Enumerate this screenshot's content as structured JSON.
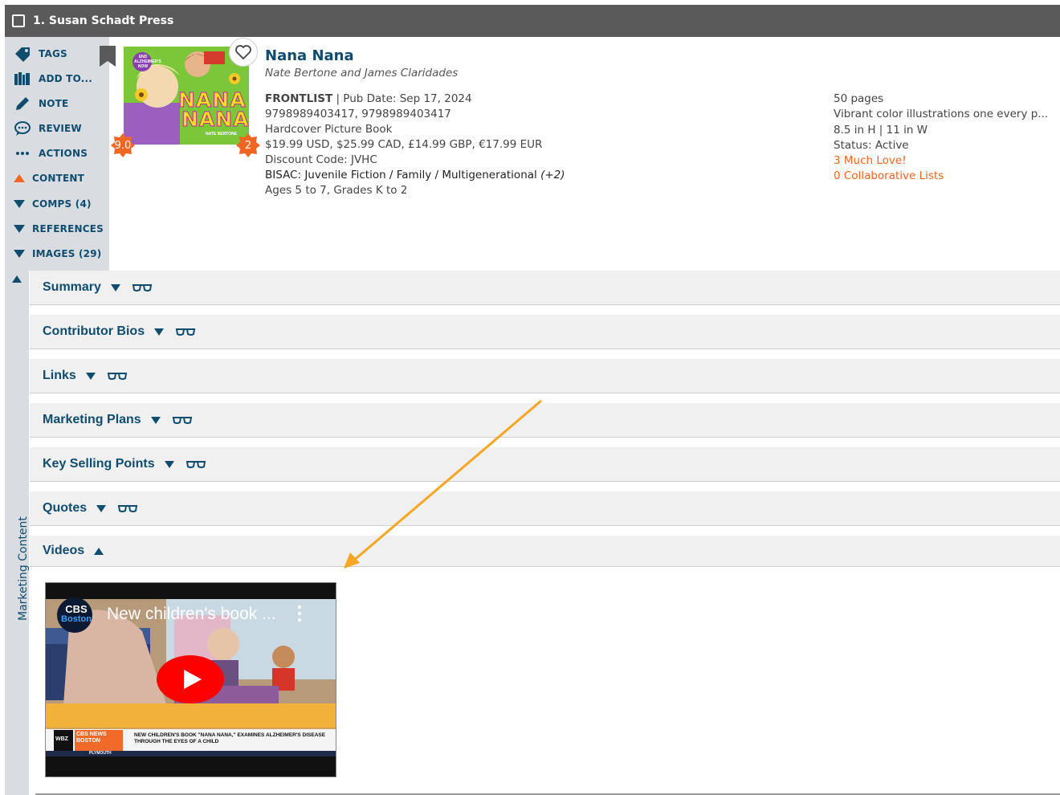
{
  "header": {
    "title": "1. Susan Schadt Press"
  },
  "sidebar": {
    "items": [
      {
        "label": "TAGS",
        "icon": "tag-icon"
      },
      {
        "label": "ADD TO...",
        "icon": "books-icon"
      },
      {
        "label": "NOTE",
        "icon": "pencil-icon"
      },
      {
        "label": "REVIEW",
        "icon": "speech-bubble-icon"
      },
      {
        "label": "ACTIONS",
        "icon": "ellipsis-icon"
      },
      {
        "label": "CONTENT",
        "icon": "triangle-up-icon"
      },
      {
        "label": "COMPS (4)",
        "icon": "triangle-down-icon"
      },
      {
        "label": "REFERENCES",
        "icon": "triangle-down-icon"
      },
      {
        "label": "IMAGES (29)",
        "icon": "triangle-down-icon"
      }
    ],
    "vertical_label": "Marketing Content"
  },
  "book": {
    "title": "Nana Nana",
    "authors": "Nate Bertone and James Claridades",
    "status_tag": "FRONTLIST",
    "pub_date": " | Pub Date: Sep 17, 2024",
    "isbns": "9798989403417, 9798989403417",
    "format": "Hardcover Picture Book",
    "prices": "$19.99 USD, $25.99 CAD, £14.99 GBP, €17.99 EUR",
    "discount": "Discount Code: JVHC",
    "bisac_label": "BISAC: ",
    "bisac": "Juvenile Fiction / Family / Multigenerational",
    "bisac_more": " (+2)",
    "ages": "Ages 5 to 7, Grades K to 2",
    "score_badge": "9.0",
    "count_badge": "2",
    "cover": {
      "line1": "NANA",
      "line2": "NANA",
      "sticker": "END ALZHEIMER'S NOW",
      "byline": "NATE BERTONE"
    }
  },
  "details": {
    "pages": "50 pages",
    "illustrations": "Vibrant color illustrations one every p...",
    "size": "8.5 in H | 11 in W",
    "status": "Status: Active",
    "love": "3 Much Love!",
    "lists": "0 Collaborative Lists"
  },
  "sections": [
    {
      "label": "Summary",
      "state": "collapsed"
    },
    {
      "label": "Contributor Bios",
      "state": "collapsed"
    },
    {
      "label": "Links",
      "state": "collapsed"
    },
    {
      "label": "Marketing Plans",
      "state": "collapsed"
    },
    {
      "label": "Key Selling Points",
      "state": "collapsed"
    },
    {
      "label": "Quotes",
      "state": "collapsed"
    },
    {
      "label": "Videos",
      "state": "expanded"
    }
  ],
  "video": {
    "title": "New children's book ...",
    "channel_logo_line1": "CBS",
    "channel_logo_line2": "Boston",
    "ticker_brand": "CBS NEWS BOSTON",
    "ticker_station": "WBZ",
    "headline": "NEW CHILDREN'S BOOK \"NANA NANA,\" EXAMINES ALZHEIMER'S DISEASE THROUGH THE EYES OF A CHILD",
    "ticker_location": "PLYMOUTH"
  },
  "colors": {
    "accent": "#0f4c6e",
    "orange": "#f26522",
    "arrow": "#f5a623",
    "header_bg": "#5a5a5a",
    "youtube_red": "#ff0000"
  }
}
